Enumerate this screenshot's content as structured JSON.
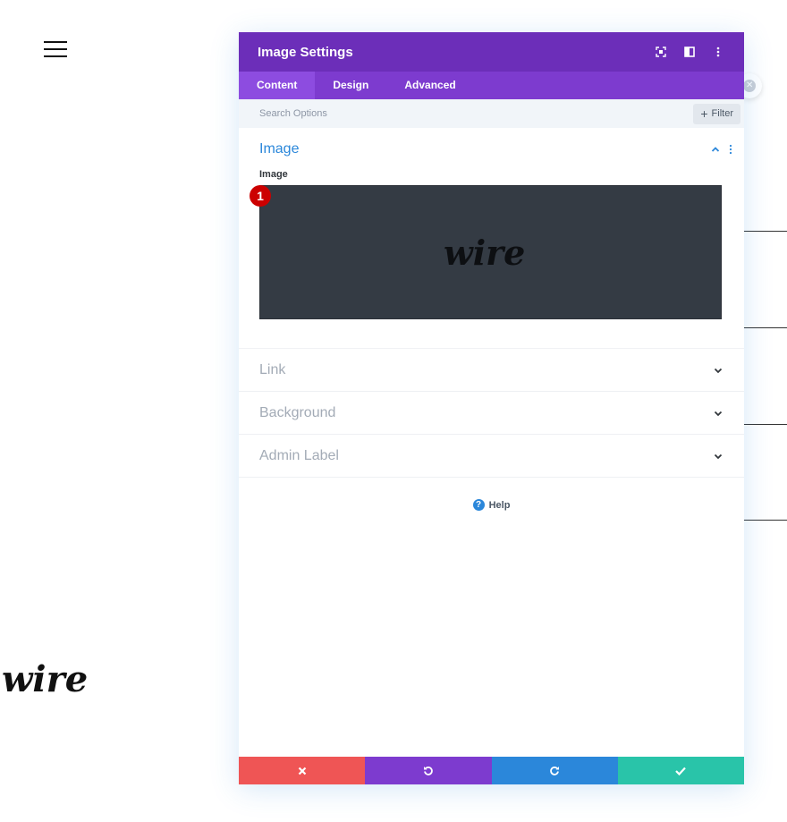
{
  "background": {
    "logo_text": "wire"
  },
  "modal": {
    "title": "Image Settings",
    "tabs": [
      {
        "label": "Content"
      },
      {
        "label": "Design"
      },
      {
        "label": "Advanced"
      }
    ],
    "search": {
      "placeholder": "Search Options"
    },
    "filter_label": "Filter",
    "sections": {
      "image": {
        "title": "Image",
        "field_label": "Image",
        "badge": "1",
        "preview_logo": "wire"
      },
      "link": {
        "title": "Link"
      },
      "background": {
        "title": "Background"
      },
      "admin_label": {
        "title": "Admin Label"
      }
    },
    "help": {
      "label": "Help",
      "icon_glyph": "?"
    }
  },
  "colors": {
    "header": "#6c2eb9",
    "tabs": "#7d3bcf",
    "accent_blue": "#2b87da",
    "cancel": "#ef5555",
    "undo": "#7d3bcf",
    "redo": "#2b87da",
    "save": "#29c4a9",
    "badge": "#cc0000"
  },
  "icons": {
    "header": [
      "expand-icon",
      "split-view-icon",
      "more-options-icon"
    ],
    "footer": [
      "close-icon",
      "undo-icon",
      "redo-icon",
      "check-icon"
    ]
  }
}
